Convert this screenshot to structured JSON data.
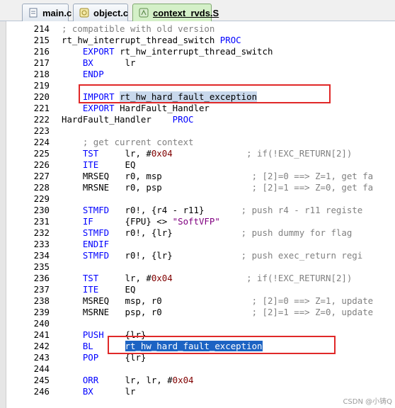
{
  "tabs": [
    {
      "label": "main.c",
      "icon": "c-file-icon",
      "active": false
    },
    {
      "label": "object.c",
      "icon": "c-file-icon",
      "active": false
    },
    {
      "label": "context_rvds.S",
      "icon": "asm-file-icon",
      "active": true
    }
  ],
  "code_lines": [
    {
      "n": "214",
      "segs": [
        {
          "t": "; compatible with old version",
          "c": "cm"
        }
      ]
    },
    {
      "n": "215",
      "segs": [
        {
          "t": "rt_hw_interrupt_thread_switch "
        },
        {
          "t": "PROC",
          "c": "kw"
        }
      ]
    },
    {
      "n": "216",
      "segs": [
        {
          "t": "    "
        },
        {
          "t": "EXPORT",
          "c": "kw"
        },
        {
          "t": " rt_hw_interrupt_thread_switch"
        }
      ]
    },
    {
      "n": "217",
      "segs": [
        {
          "t": "    "
        },
        {
          "t": "BX",
          "c": "kw"
        },
        {
          "t": "      lr"
        }
      ]
    },
    {
      "n": "218",
      "segs": [
        {
          "t": "    "
        },
        {
          "t": "ENDP",
          "c": "kw"
        }
      ]
    },
    {
      "n": "219",
      "segs": []
    },
    {
      "n": "220",
      "segs": [
        {
          "t": "    "
        },
        {
          "t": "IMPORT",
          "c": "kw"
        },
        {
          "t": " "
        },
        {
          "t": "rt_hw_hard_fault_exception",
          "c": "sel-light"
        }
      ]
    },
    {
      "n": "221",
      "segs": [
        {
          "t": "    "
        },
        {
          "t": "EXPORT",
          "c": "kw"
        },
        {
          "t": " HardFault_Handler"
        }
      ]
    },
    {
      "n": "222",
      "segs": [
        {
          "t": "HardFault_Handler    "
        },
        {
          "t": "PROC",
          "c": "kw"
        }
      ]
    },
    {
      "n": "223",
      "segs": []
    },
    {
      "n": "224",
      "segs": [
        {
          "t": "    "
        },
        {
          "t": "; get current context",
          "c": "cm"
        }
      ]
    },
    {
      "n": "225",
      "segs": [
        {
          "t": "    "
        },
        {
          "t": "TST",
          "c": "kw"
        },
        {
          "t": "     lr, #"
        },
        {
          "t": "0x04",
          "c": "num"
        },
        {
          "t": "              "
        },
        {
          "t": "; if(!EXC_RETURN[2])",
          "c": "cm"
        }
      ]
    },
    {
      "n": "226",
      "segs": [
        {
          "t": "    "
        },
        {
          "t": "ITE",
          "c": "kw"
        },
        {
          "t": "     EQ"
        }
      ]
    },
    {
      "n": "227",
      "segs": [
        {
          "t": "    MRSEQ   r0, msp                 "
        },
        {
          "t": "; [2]=0 ==> Z=1, get fa",
          "c": "cm"
        }
      ]
    },
    {
      "n": "228",
      "segs": [
        {
          "t": "    MRSNE   r0, psp                 "
        },
        {
          "t": "; [2]=1 ==> Z=0, get fa",
          "c": "cm"
        }
      ]
    },
    {
      "n": "229",
      "segs": []
    },
    {
      "n": "230",
      "segs": [
        {
          "t": "    "
        },
        {
          "t": "STMFD",
          "c": "kw"
        },
        {
          "t": "   r0!, {r4 - r11}       "
        },
        {
          "t": "; push r4 - r11 registe",
          "c": "cm"
        }
      ]
    },
    {
      "n": "231",
      "segs": [
        {
          "t": "    "
        },
        {
          "t": "IF",
          "c": "kw"
        },
        {
          "t": "      {FPU} <> "
        },
        {
          "t": "\"SoftVFP\"",
          "c": "str"
        }
      ]
    },
    {
      "n": "232",
      "segs": [
        {
          "t": "    "
        },
        {
          "t": "STMFD",
          "c": "kw"
        },
        {
          "t": "   r0!, {lr}             "
        },
        {
          "t": "; push dummy for flag",
          "c": "cm"
        }
      ]
    },
    {
      "n": "233",
      "segs": [
        {
          "t": "    "
        },
        {
          "t": "ENDIF",
          "c": "kw"
        }
      ]
    },
    {
      "n": "234",
      "segs": [
        {
          "t": "    "
        },
        {
          "t": "STMFD",
          "c": "kw"
        },
        {
          "t": "   r0!, {lr}             "
        },
        {
          "t": "; push exec_return regi",
          "c": "cm"
        }
      ]
    },
    {
      "n": "235",
      "segs": []
    },
    {
      "n": "236",
      "segs": [
        {
          "t": "    "
        },
        {
          "t": "TST",
          "c": "kw"
        },
        {
          "t": "     lr, #"
        },
        {
          "t": "0x04",
          "c": "num"
        },
        {
          "t": "              "
        },
        {
          "t": "; if(!EXC_RETURN[2])",
          "c": "cm"
        }
      ]
    },
    {
      "n": "237",
      "segs": [
        {
          "t": "    "
        },
        {
          "t": "ITE",
          "c": "kw"
        },
        {
          "t": "     EQ"
        }
      ]
    },
    {
      "n": "238",
      "segs": [
        {
          "t": "    MSREQ   msp, r0                 "
        },
        {
          "t": "; [2]=0 ==> Z=1, update",
          "c": "cm"
        }
      ]
    },
    {
      "n": "239",
      "segs": [
        {
          "t": "    MSRNE   psp, r0                 "
        },
        {
          "t": "; [2]=1 ==> Z=0, update",
          "c": "cm"
        }
      ]
    },
    {
      "n": "240",
      "segs": []
    },
    {
      "n": "241",
      "segs": [
        {
          "t": "    "
        },
        {
          "t": "PUSH",
          "c": "kw"
        },
        {
          "t": "    {lr}"
        }
      ]
    },
    {
      "n": "242",
      "segs": [
        {
          "t": "    "
        },
        {
          "t": "BL",
          "c": "kw"
        },
        {
          "t": "      "
        },
        {
          "t": "rt_hw_hard_fault_exception",
          "c": "sel-dark"
        }
      ]
    },
    {
      "n": "243",
      "segs": [
        {
          "t": "    "
        },
        {
          "t": "POP",
          "c": "kw"
        },
        {
          "t": "     {lr}"
        }
      ]
    },
    {
      "n": "244",
      "segs": []
    },
    {
      "n": "245",
      "segs": [
        {
          "t": "    "
        },
        {
          "t": "ORR",
          "c": "kw"
        },
        {
          "t": "     lr, lr, #"
        },
        {
          "t": "0x04",
          "c": "num"
        }
      ]
    },
    {
      "n": "246",
      "segs": [
        {
          "t": "    "
        },
        {
          "t": "BX",
          "c": "kw"
        },
        {
          "t": "      lr"
        }
      ]
    }
  ],
  "colors": {
    "keyword": "#0000ff",
    "comment": "#808080",
    "number": "#800000",
    "string": "#800080",
    "highlight_box": "#e02828",
    "selection_dark": "#1c63c3",
    "selection_light": "#c8d8ec"
  },
  "watermark": "CSDN @小铸Q"
}
